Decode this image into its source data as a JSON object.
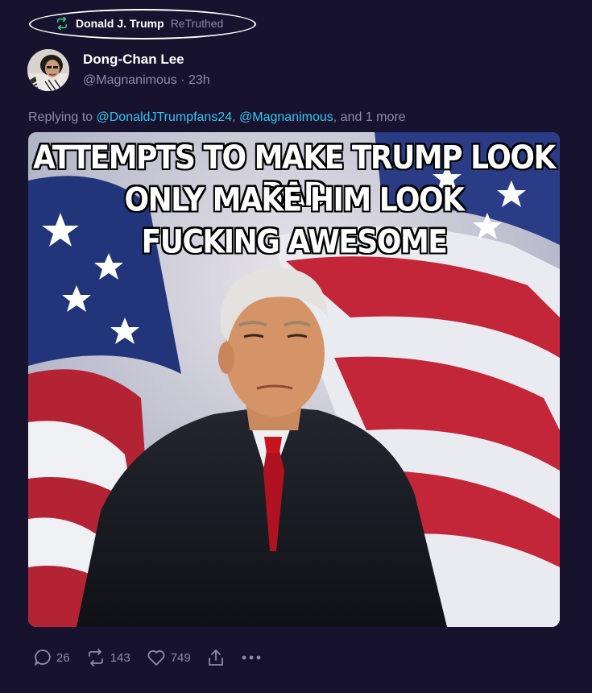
{
  "retruth": {
    "name": "Donald J. Trump",
    "verb": "ReTruthed",
    "icon": "retruth-icon",
    "icon_color": "#3ec773"
  },
  "post": {
    "author_name": "Dong-Chan Lee",
    "author_handle": "@Magnanimous",
    "separator": " · ",
    "time": "23h",
    "reply_prefix": "Replying to ",
    "mention_1": "@DonaldJTrumpfans24",
    "comma": ", ",
    "mention_2": "@Magnanimous",
    "reply_suffix": ", and 1 more",
    "mention_color": "#36c5f0"
  },
  "media": {
    "line_1": "ATTEMPTS TO MAKE TRUMP LOOK BAD",
    "line_2": "ONLY MAKE HIM LOOK",
    "line_3": "FUCKING AWESOME"
  },
  "actions": {
    "replies": "26",
    "retruths": "143",
    "likes": "749",
    "reply_icon": "reply-icon",
    "retruth_icon": "retruth-icon",
    "like_icon": "heart-icon",
    "share_icon": "share-icon",
    "more_icon": "more-icon"
  },
  "colors": {
    "background": "#17132e",
    "muted_text": "#8f8aa8"
  }
}
